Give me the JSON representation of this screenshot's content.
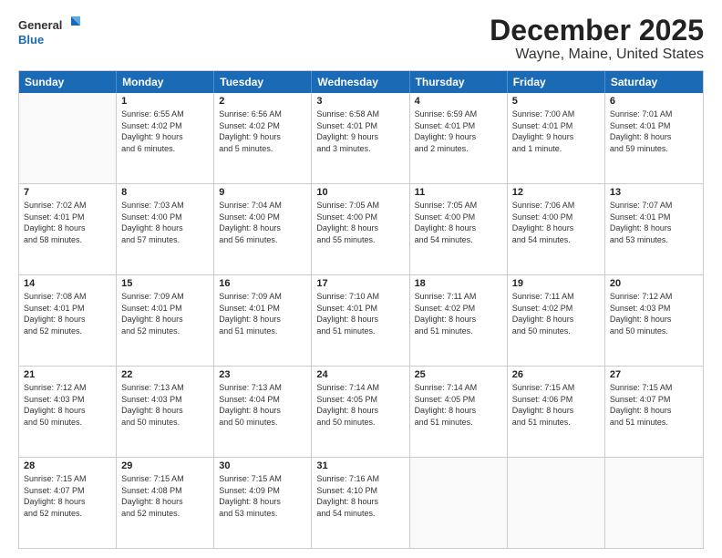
{
  "logo": {
    "line1": "General",
    "line2": "Blue"
  },
  "title": "December 2025",
  "subtitle": "Wayne, Maine, United States",
  "header_days": [
    "Sunday",
    "Monday",
    "Tuesday",
    "Wednesday",
    "Thursday",
    "Friday",
    "Saturday"
  ],
  "weeks": [
    [
      {
        "day": "",
        "info": ""
      },
      {
        "day": "1",
        "info": "Sunrise: 6:55 AM\nSunset: 4:02 PM\nDaylight: 9 hours\nand 6 minutes."
      },
      {
        "day": "2",
        "info": "Sunrise: 6:56 AM\nSunset: 4:02 PM\nDaylight: 9 hours\nand 5 minutes."
      },
      {
        "day": "3",
        "info": "Sunrise: 6:58 AM\nSunset: 4:01 PM\nDaylight: 9 hours\nand 3 minutes."
      },
      {
        "day": "4",
        "info": "Sunrise: 6:59 AM\nSunset: 4:01 PM\nDaylight: 9 hours\nand 2 minutes."
      },
      {
        "day": "5",
        "info": "Sunrise: 7:00 AM\nSunset: 4:01 PM\nDaylight: 9 hours\nand 1 minute."
      },
      {
        "day": "6",
        "info": "Sunrise: 7:01 AM\nSunset: 4:01 PM\nDaylight: 8 hours\nand 59 minutes."
      }
    ],
    [
      {
        "day": "7",
        "info": "Sunrise: 7:02 AM\nSunset: 4:01 PM\nDaylight: 8 hours\nand 58 minutes."
      },
      {
        "day": "8",
        "info": "Sunrise: 7:03 AM\nSunset: 4:00 PM\nDaylight: 8 hours\nand 57 minutes."
      },
      {
        "day": "9",
        "info": "Sunrise: 7:04 AM\nSunset: 4:00 PM\nDaylight: 8 hours\nand 56 minutes."
      },
      {
        "day": "10",
        "info": "Sunrise: 7:05 AM\nSunset: 4:00 PM\nDaylight: 8 hours\nand 55 minutes."
      },
      {
        "day": "11",
        "info": "Sunrise: 7:05 AM\nSunset: 4:00 PM\nDaylight: 8 hours\nand 54 minutes."
      },
      {
        "day": "12",
        "info": "Sunrise: 7:06 AM\nSunset: 4:00 PM\nDaylight: 8 hours\nand 54 minutes."
      },
      {
        "day": "13",
        "info": "Sunrise: 7:07 AM\nSunset: 4:01 PM\nDaylight: 8 hours\nand 53 minutes."
      }
    ],
    [
      {
        "day": "14",
        "info": "Sunrise: 7:08 AM\nSunset: 4:01 PM\nDaylight: 8 hours\nand 52 minutes."
      },
      {
        "day": "15",
        "info": "Sunrise: 7:09 AM\nSunset: 4:01 PM\nDaylight: 8 hours\nand 52 minutes."
      },
      {
        "day": "16",
        "info": "Sunrise: 7:09 AM\nSunset: 4:01 PM\nDaylight: 8 hours\nand 51 minutes."
      },
      {
        "day": "17",
        "info": "Sunrise: 7:10 AM\nSunset: 4:01 PM\nDaylight: 8 hours\nand 51 minutes."
      },
      {
        "day": "18",
        "info": "Sunrise: 7:11 AM\nSunset: 4:02 PM\nDaylight: 8 hours\nand 51 minutes."
      },
      {
        "day": "19",
        "info": "Sunrise: 7:11 AM\nSunset: 4:02 PM\nDaylight: 8 hours\nand 50 minutes."
      },
      {
        "day": "20",
        "info": "Sunrise: 7:12 AM\nSunset: 4:03 PM\nDaylight: 8 hours\nand 50 minutes."
      }
    ],
    [
      {
        "day": "21",
        "info": "Sunrise: 7:12 AM\nSunset: 4:03 PM\nDaylight: 8 hours\nand 50 minutes."
      },
      {
        "day": "22",
        "info": "Sunrise: 7:13 AM\nSunset: 4:03 PM\nDaylight: 8 hours\nand 50 minutes."
      },
      {
        "day": "23",
        "info": "Sunrise: 7:13 AM\nSunset: 4:04 PM\nDaylight: 8 hours\nand 50 minutes."
      },
      {
        "day": "24",
        "info": "Sunrise: 7:14 AM\nSunset: 4:05 PM\nDaylight: 8 hours\nand 50 minutes."
      },
      {
        "day": "25",
        "info": "Sunrise: 7:14 AM\nSunset: 4:05 PM\nDaylight: 8 hours\nand 51 minutes."
      },
      {
        "day": "26",
        "info": "Sunrise: 7:15 AM\nSunset: 4:06 PM\nDaylight: 8 hours\nand 51 minutes."
      },
      {
        "day": "27",
        "info": "Sunrise: 7:15 AM\nSunset: 4:07 PM\nDaylight: 8 hours\nand 51 minutes."
      }
    ],
    [
      {
        "day": "28",
        "info": "Sunrise: 7:15 AM\nSunset: 4:07 PM\nDaylight: 8 hours\nand 52 minutes."
      },
      {
        "day": "29",
        "info": "Sunrise: 7:15 AM\nSunset: 4:08 PM\nDaylight: 8 hours\nand 52 minutes."
      },
      {
        "day": "30",
        "info": "Sunrise: 7:15 AM\nSunset: 4:09 PM\nDaylight: 8 hours\nand 53 minutes."
      },
      {
        "day": "31",
        "info": "Sunrise: 7:16 AM\nSunset: 4:10 PM\nDaylight: 8 hours\nand 54 minutes."
      },
      {
        "day": "",
        "info": ""
      },
      {
        "day": "",
        "info": ""
      },
      {
        "day": "",
        "info": ""
      }
    ]
  ]
}
